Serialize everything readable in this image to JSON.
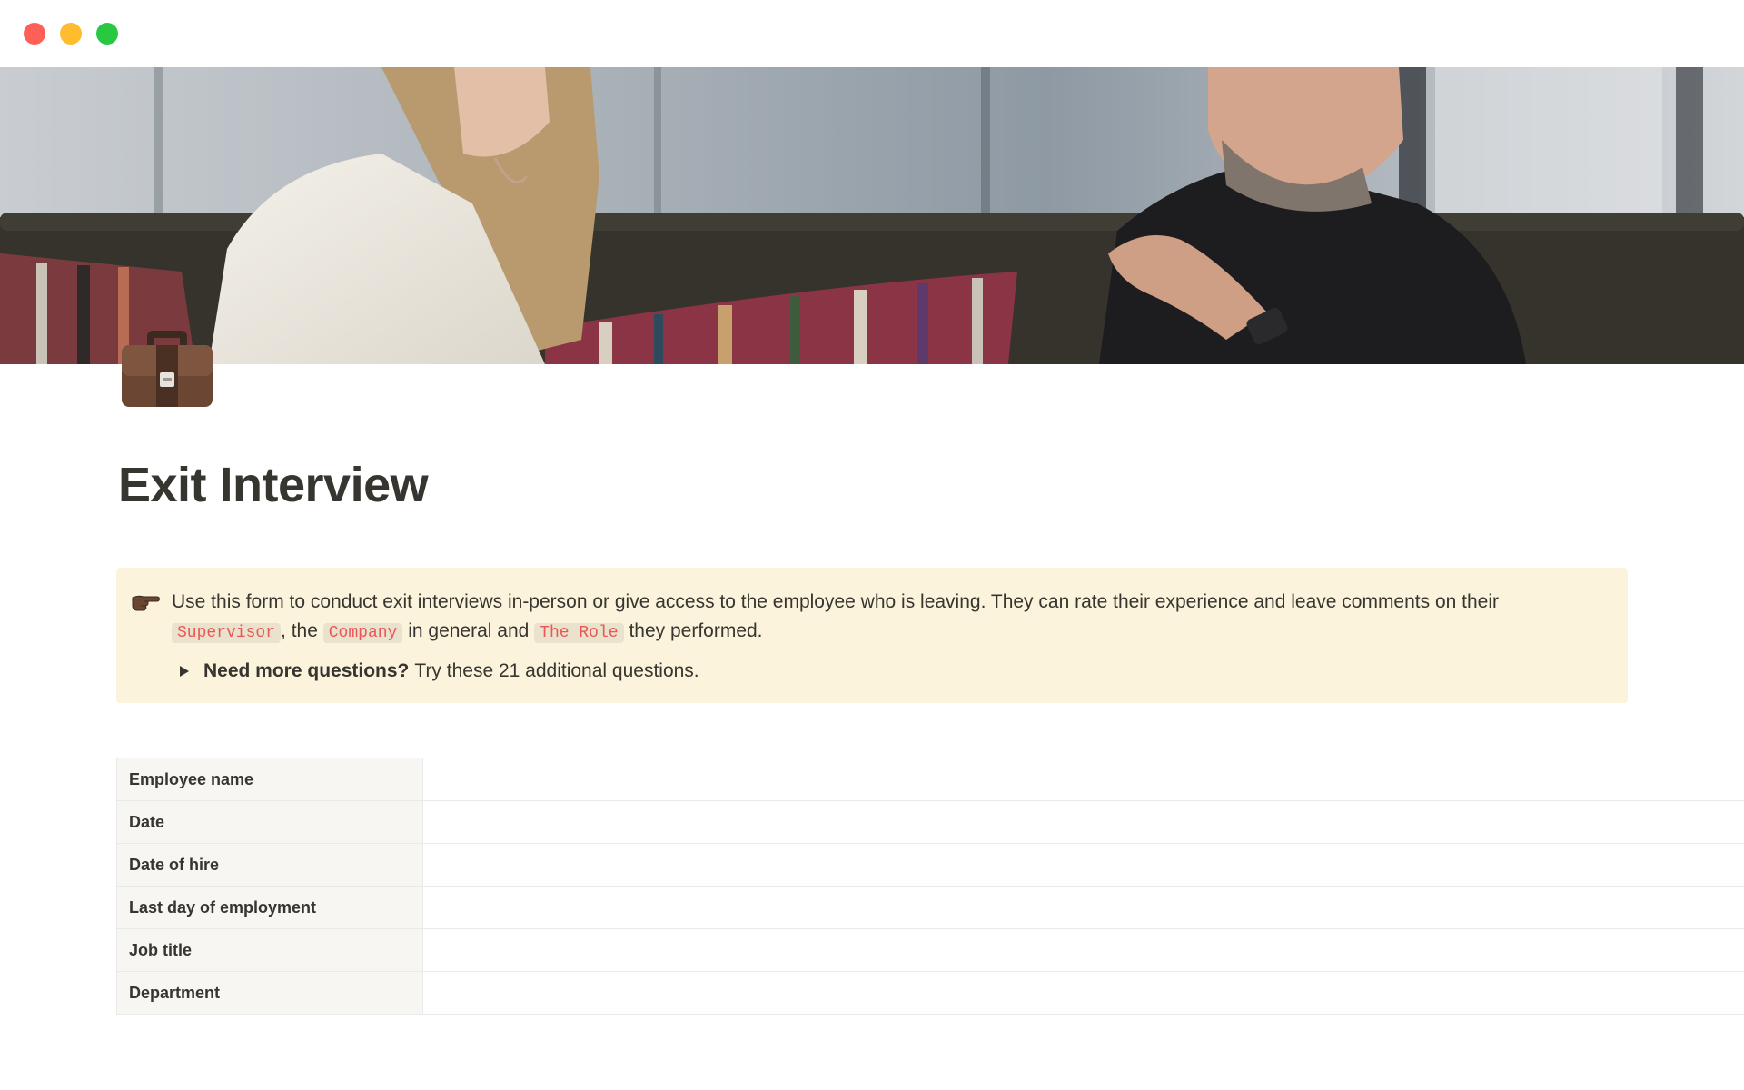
{
  "window": {
    "controls": [
      "close",
      "minimize",
      "zoom"
    ]
  },
  "page": {
    "icon": "briefcase-icon",
    "title": "Exit Interview"
  },
  "callout": {
    "icon": "pointing-hand-icon",
    "text_1": "Use this form to conduct exit interviews in-person or give access to the employee who is leaving. They can rate their experience and leave comments on their",
    "code_1": "Supervisor",
    "text_2": ", the",
    "code_2": "Company",
    "text_3": "in general and",
    "code_3": "The Role",
    "text_4": "they performed.",
    "toggle_bold": "Need more questions?",
    "toggle_text": "Try these 21 additional questions."
  },
  "properties": [
    {
      "label": "Employee name",
      "value": ""
    },
    {
      "label": "Date",
      "value": ""
    },
    {
      "label": "Date of hire",
      "value": ""
    },
    {
      "label": "Last day of employment",
      "value": ""
    },
    {
      "label": "Job title",
      "value": ""
    },
    {
      "label": "Department",
      "value": ""
    }
  ],
  "colors": {
    "callout_bg": "#fbf3db",
    "code_text": "#eb5757",
    "property_key_bg": "#f7f6f3"
  }
}
